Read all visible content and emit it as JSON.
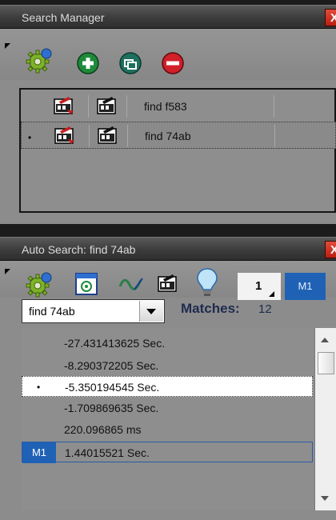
{
  "search_manager": {
    "title": "Search Manager",
    "close_label": "X",
    "toolbar": {
      "icons": [
        "settings-gear-icon",
        "add-icon",
        "duplicate-icon",
        "remove-icon"
      ]
    },
    "searches": [
      {
        "name": "find f583",
        "selected": false
      },
      {
        "name": "find 74ab",
        "selected": true,
        "bullet": "•"
      }
    ]
  },
  "auto_search": {
    "title": "Auto Search: find 74ab",
    "close_label": "X",
    "toolbar": {
      "icons": [
        "settings-gear-icon",
        "capture-icon",
        "waveform-icon",
        "edit-search-icon",
        "lightbulb-icon"
      ],
      "mark_number": "1",
      "mark_label": "M1"
    },
    "combo_value": "find 74ab",
    "matches_label": "Matches:",
    "matches_count": "12",
    "matches": [
      {
        "value": "-27.431413625 Sec."
      },
      {
        "value": "-8.290372205 Sec."
      },
      {
        "value": "-5.350194545 Sec.",
        "selected": true,
        "bullet": "•"
      },
      {
        "value": "-1.709869635 Sec."
      },
      {
        "value": "220.096865 ms"
      },
      {
        "value": "1.44015521 Sec.",
        "marker": "M1"
      }
    ]
  },
  "colors": {
    "background": "#8c8c8c",
    "titlebar": "#3e3e3e",
    "close_button": "#c62a1a",
    "marker_blue": "#1f62b5",
    "add_green": "#1e8a3a",
    "remove_red": "#d0202a"
  }
}
